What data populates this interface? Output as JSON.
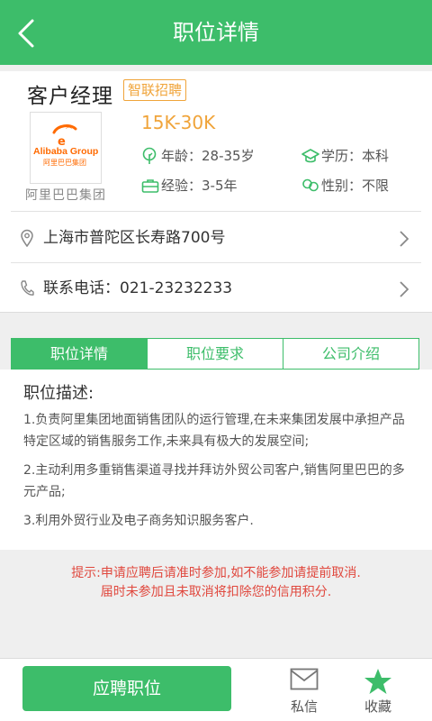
{
  "header": {
    "title": "职位详情"
  },
  "job": {
    "title": "客户经理",
    "badge": "智联招聘",
    "salary": "15K-30K",
    "age": "年龄：28-35岁",
    "education": "学历：本科",
    "experience": "经验：3-5年",
    "gender": "性别：不限"
  },
  "company": {
    "logo_text": "Alibaba Group",
    "logo_subtext": "阿里巴巴集团",
    "name": "阿里巴巴集团"
  },
  "address": "上海市普陀区长寿路700号",
  "phone": "联系电话：021-23232233",
  "tabs": [
    {
      "label": "职位详情"
    },
    {
      "label": "职位要求"
    },
    {
      "label": "公司介绍"
    }
  ],
  "description": {
    "title": "职位描述:",
    "items": [
      "1.负责阿里集团地面销售团队的运行管理,在未来集团发展中承担产品特定区域的销售服务工作,未来具有极大的发展空间;",
      "2.主动利用多重销售渠道寻找并拜访外贸公司客户,销售阿里巴巴的多元产品;",
      "3.利用外贸行业及电子商务知识服务客户."
    ]
  },
  "notice": {
    "line1": "提示:申请应聘后请准时参加,如不能参加请提前取消.",
    "line2": "届时未参加且未取消将扣除您的信用积分."
  },
  "bottom": {
    "apply_label": "应聘职位",
    "message_label": "私信",
    "favorite_label": "收藏"
  },
  "colors": {
    "primary": "#3dbd6a",
    "accent": "#f0a43a",
    "notice": "#e0483e"
  },
  "icons": [
    "back-arrow-icon",
    "age-icon",
    "education-icon",
    "experience-icon",
    "gender-icon",
    "location-icon",
    "phone-icon",
    "chevron-right-icon",
    "message-icon",
    "star-icon"
  ]
}
